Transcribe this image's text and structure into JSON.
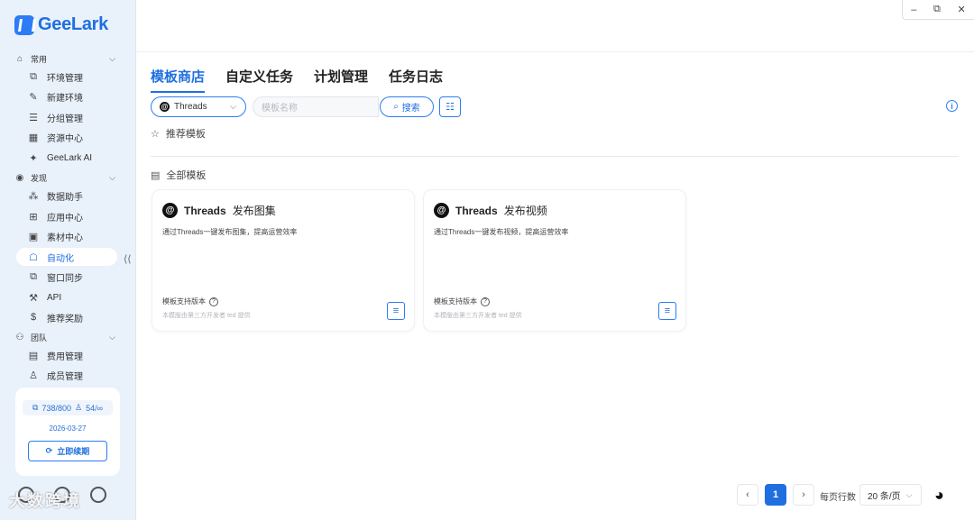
{
  "app": {
    "name": "GeeLark"
  },
  "window_controls": {
    "minimize": "–",
    "restore": "⧉",
    "close": "✕"
  },
  "sidebar": {
    "groups": [
      {
        "label": "常用",
        "items": [
          "环境管理",
          "新建环境",
          "分组管理",
          "资源中心",
          "GeeLark AI"
        ]
      },
      {
        "label": "发现",
        "items": [
          "数据助手",
          "应用中心",
          "素材中心",
          "自动化",
          "窗口同步",
          "API",
          "推荐奖励"
        ]
      },
      {
        "label": "团队",
        "items": [
          "费用管理",
          "成员管理"
        ]
      }
    ],
    "active_item": "自动化",
    "collapse_icon": "double-chevron-left-icon"
  },
  "quota": {
    "envs": "738/800",
    "members": "54/∞",
    "date": "2026-03-27",
    "renew_label": "立即续期"
  },
  "watermark": "大数跨境",
  "tabs": [
    "模板商店",
    "自定义任务",
    "计划管理",
    "任务日志"
  ],
  "active_tab": "模板商店",
  "filters": {
    "platform": "Threads",
    "search_placeholder": "模板名称",
    "search_label": "搜索"
  },
  "sections": {
    "recommended": "推荐模板",
    "all": "全部模板"
  },
  "cards": [
    {
      "brand": "Threads",
      "title": "发布图集",
      "description": "通过Threads一键发布图集，提高运营效率",
      "version_label": "模板支持版本",
      "developer": "本模版由第三方开发者 ted 提供"
    },
    {
      "brand": "Threads",
      "title": "发布视频",
      "description": "通过Threads一键发布视频，提高运营效率",
      "version_label": "模板支持版本",
      "developer": "本模版由第三方开发者 ted 提供"
    }
  ],
  "pagination": {
    "prev": "‹",
    "current": "1",
    "next": "›",
    "rows_label": "每页行数",
    "page_size": "20 条/页"
  },
  "colors": {
    "accent": "#1f6fe0",
    "sidebar_bg": "#e9f1fb"
  }
}
